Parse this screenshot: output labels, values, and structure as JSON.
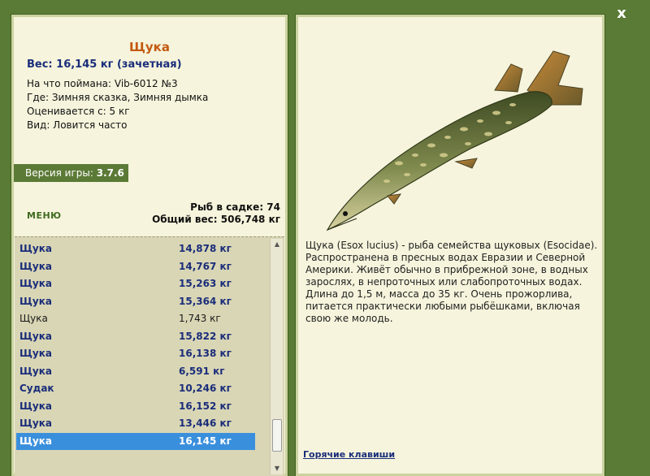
{
  "window": {
    "close_label": "x"
  },
  "fish": {
    "title": "Щука",
    "weight_line": "Вес: 16,145 кг (зачетная)",
    "info": [
      "На что поймана: Vib-6012 №3",
      "Где: Зимняя сказка, Зимняя дымка",
      "Оценивается с: 5 кг",
      "Вид: Ловится часто"
    ]
  },
  "version": {
    "label": "Версия игры:",
    "value": "3.7.6"
  },
  "menu": {
    "label": "МЕНЮ"
  },
  "stats": {
    "count_line": "Рыб в садке: 74",
    "total_line": "Общий вес: 506,748 кг"
  },
  "catch_list": [
    {
      "name": "Щука",
      "weight": "14,878 кг",
      "style": "bold"
    },
    {
      "name": "Щука",
      "weight": "14,767 кг",
      "style": "bold"
    },
    {
      "name": "Щука",
      "weight": "15,263 кг",
      "style": "bold"
    },
    {
      "name": "Щука",
      "weight": "15,364 кг",
      "style": "bold"
    },
    {
      "name": "Щука",
      "weight": "1,743 кг",
      "style": "normal"
    },
    {
      "name": "Щука",
      "weight": "15,822 кг",
      "style": "bold"
    },
    {
      "name": "Щука",
      "weight": "16,138 кг",
      "style": "bold"
    },
    {
      "name": "Щука",
      "weight": "6,591 кг",
      "style": "bold"
    },
    {
      "name": "Судак",
      "weight": "10,246 кг",
      "style": "bold"
    },
    {
      "name": "Щука",
      "weight": "16,152 кг",
      "style": "bold"
    },
    {
      "name": "Щука",
      "weight": "13,446 кг",
      "style": "bold"
    },
    {
      "name": "Щука",
      "weight": "16,145 кг",
      "style": "selected"
    }
  ],
  "description": "Щука (Esox lucius) - рыба семейства щуковых (Esocidae). Распространена в пресных водах Евразии и Северной Америки. Живёт обычно в прибрежной зоне, в водных зарослях, в непроточных или слабопроточных водах. Длина до 1,5 м, масса до 35 кг. Очень прожорлива, питается практически любыми рыбёшками, включая свою же молодь.",
  "hotkeys_label": "Горячие клавиши",
  "colors": {
    "frame_green": "#597b35",
    "panel_bg": "#f6f4dc",
    "title_orange": "#c45a12",
    "link_blue": "#1a2d7a",
    "selected_blue": "#3a8fdc"
  }
}
